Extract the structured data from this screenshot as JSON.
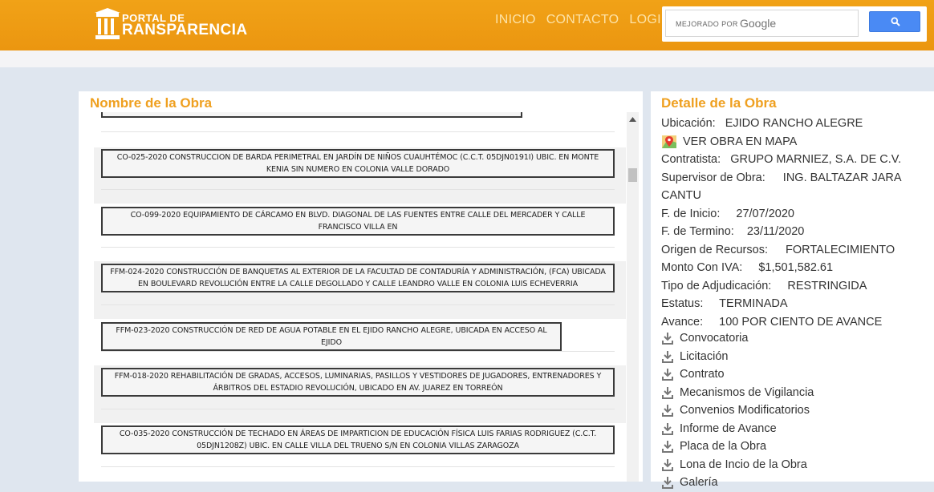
{
  "header": {
    "logo_small": "PORTAL DE",
    "logo_big": "RANSPARENCIA",
    "nav": [
      "INICIO",
      "CONTACTO",
      "LOGIN"
    ],
    "search": {
      "powered_by": "MEJORADO POR",
      "google": "Google",
      "button_icon": "search-icon"
    }
  },
  "left": {
    "title": "Nombre de la Obra",
    "partial_top": "...",
    "items": [
      "CO-025-2020 CONSTRUCCION DE BARDA PERIMETRAL EN JARDÍN DE NIÑOS CUAUHTÉMOC (C.C.T. 05DJN0191I) UBIC. EN MONTE KENIA SIN NUMERO EN COLONIA VALLE DORADO",
      "CO-099-2020 EQUIPAMIENTO DE CÁRCAMO EN BLVD. DIAGONAL DE LAS FUENTES ENTRE CALLE DEL MERCADER Y CALLE FRANCISCO VILLA EN",
      "FFM-024-2020 CONSTRUCCIÓN DE BANQUETAS AL EXTERIOR DE LA FACULTAD DE CONTADURÍA Y ADMINISTRACIÓN, (FCA) UBICADA EN BOULEVARD REVOLUCIÓN ENTRE LA CALLE DEGOLLADO Y CALLE LEANDRO VALLE EN COLONIA LUIS ECHEVERRIA",
      "FFM-023-2020 CONSTRUCCIÓN DE RED DE AGUA POTABLE EN EL EJIDO RANCHO ALEGRE, UBICADA EN ACCESO AL EJIDO",
      "FFM-018-2020 REHABILITACIÓN DE GRADAS, ACCESOS, LUMINARIAS, PASILLOS Y VESTIDORES DE JUGADORES, ENTRENADORES Y ÁRBITROS DEL ESTADIO REVOLUCIÓN, UBICADO EN AV. JUAREZ EN TORREÓN",
      "CO-035-2020 CONSTRUCCIÓN DE TECHADO EN ÁREAS DE IMPARTICION DE EDUCACIÓN FÍSICA LUIS FARIAS RODRIGUEZ (C.C.T. 05DJN1208Z) UBIC. EN CALLE VILLA DEL TRUENO S/N EN COLONIA VILLAS ZARAGOZA"
    ]
  },
  "right": {
    "title": "Detalle de la Obra",
    "ubicacion_label": "Ubicación:",
    "ubicacion": "EJIDO RANCHO ALEGRE",
    "map_link": "VER OBRA EN MAPA",
    "contratista_label": "Contratista:",
    "contratista": "GRUPO MARNIEZ, S.A. DE C.V.",
    "supervisor_label": "Supervisor de Obra:",
    "supervisor": "ING. BALTAZAR JARA CANTU",
    "inicio_label": "F. de Inicio:",
    "inicio": "27/07/2020",
    "termino_label": "F. de Termino:",
    "termino": "23/11/2020",
    "origen_label": "Origen de Recursos:",
    "origen": "FORTALECIMIENTO",
    "monto_label": "Monto Con IVA:",
    "monto": "$1,501,582.61",
    "tipo_label": "Tipo de Adjudicación:",
    "tipo": "RESTRINGIDA",
    "estatus_label": "Estatus:",
    "estatus": "TERMINADA",
    "avance_label": "Avance:",
    "avance": "100 POR CIENTO DE AVANCE",
    "docs": [
      "Convocatoria",
      "Licitación",
      "Contrato",
      "Mecanismos de Vigilancia",
      "Convenios Modificatorios",
      "Informe de Avance",
      "Placa de la Obra",
      "Lona de Incio de la Obra",
      "Galería"
    ]
  },
  "colors": {
    "header": "#ee9c14",
    "accent": "#efa020",
    "search_button": "#4a8af4"
  }
}
